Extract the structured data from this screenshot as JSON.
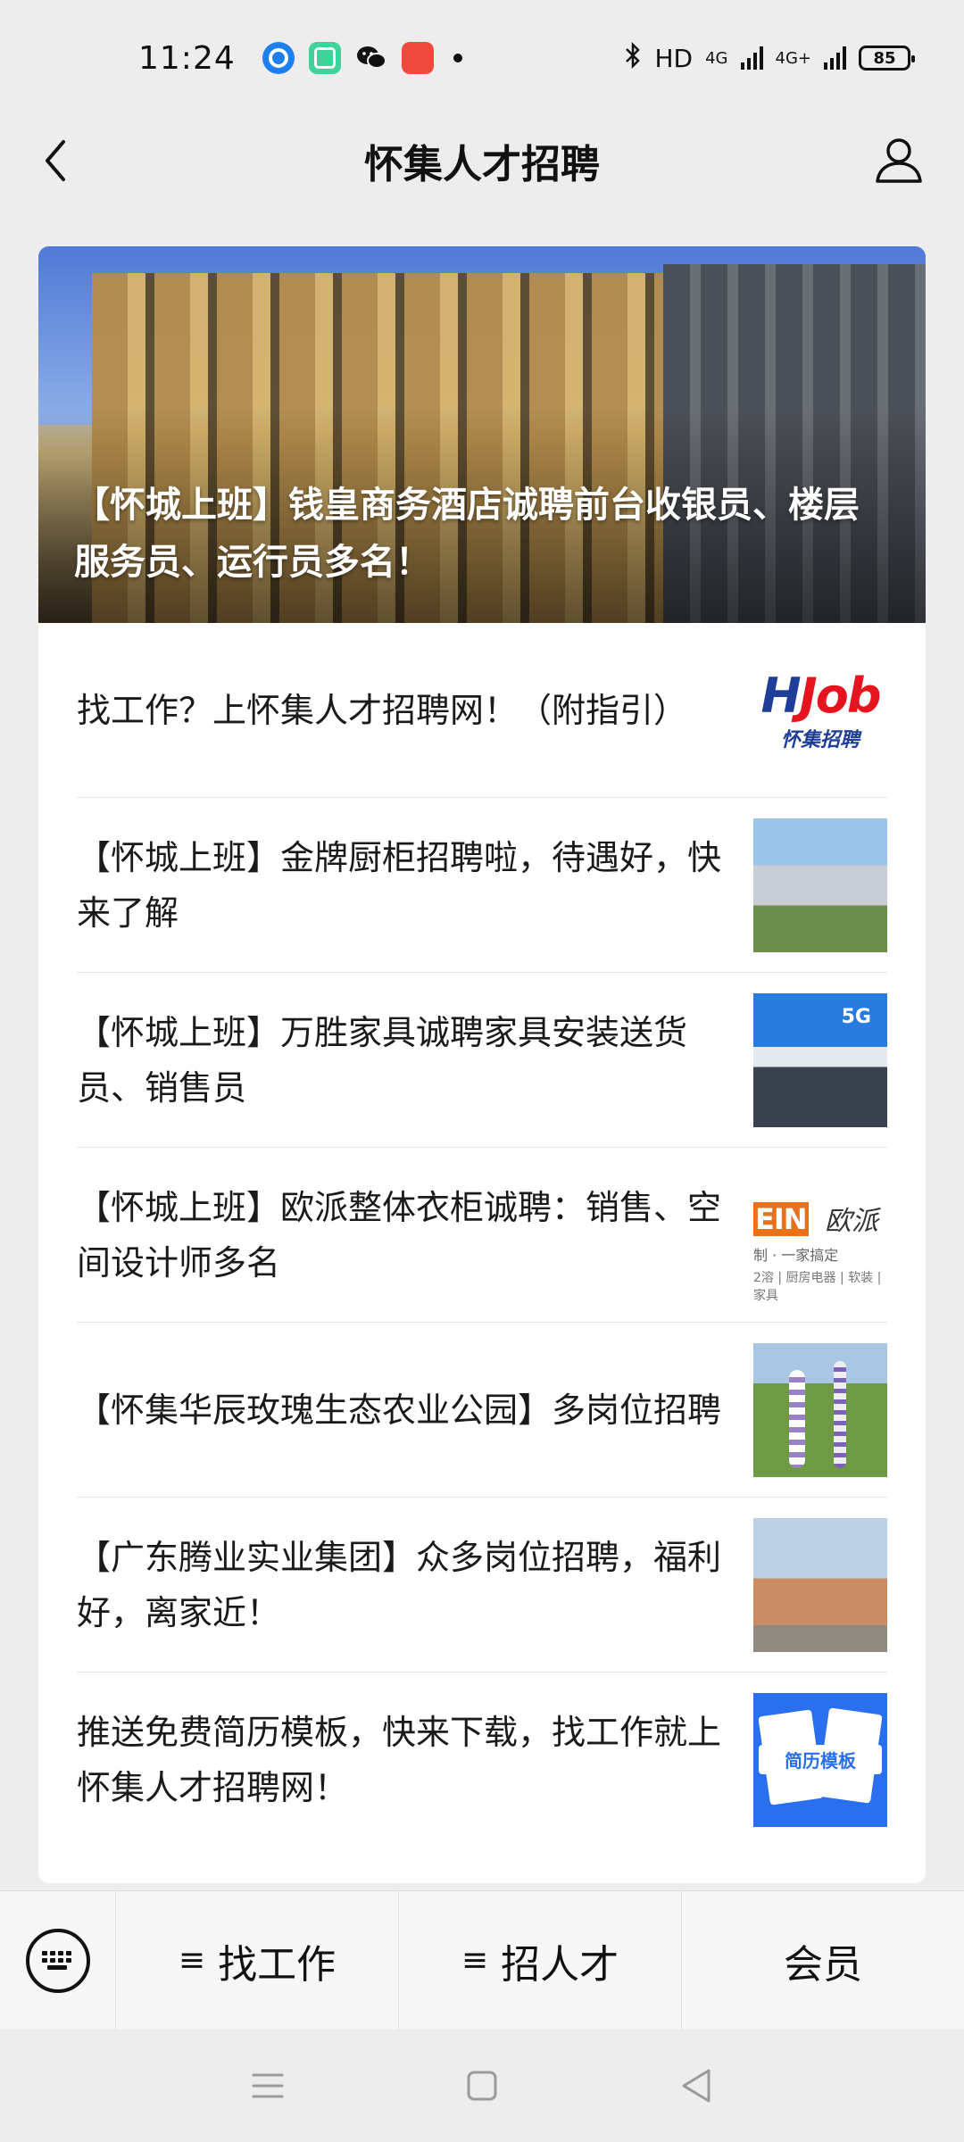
{
  "status_bar": {
    "time": "11:24",
    "app_icons": [
      "qq-browser-icon",
      "app-icon",
      "wechat-icon",
      "red-app-icon"
    ],
    "network": "HD",
    "signal1": "4G",
    "signal2": "4G+",
    "battery": "85"
  },
  "header": {
    "title": "怀集人才招聘"
  },
  "hero": {
    "title": "【怀城上班】钱皇商务酒店诚聘前台收银员、楼层服务员、运行员多名！"
  },
  "articles": [
    {
      "title": "找工作？上怀集人才招聘网！（附指引）",
      "thumb": "logo",
      "logo_main": "Job",
      "logo_letter": "H",
      "logo_sub": "怀集招聘"
    },
    {
      "title": "【怀城上班】金牌厨柜招聘啦，待遇好，快来了解",
      "thumb": "factory"
    },
    {
      "title": "【怀城上班】万胜家具诚聘家具安装送货员、销售员",
      "thumb": "store"
    },
    {
      "title": "【怀城上班】欧派整体衣柜诚聘：销售、空间设计师多名",
      "thumb": "brand",
      "brand_a": "EIN",
      "brand_b": "欧派",
      "brand_c": "制 · 一家搞定",
      "brand_d": "2溶 | 厨房电器 | 软装 | 家具"
    },
    {
      "title": "【怀集华辰玫瑰生态农业公园】多岗位招聘",
      "thumb": "garden"
    },
    {
      "title": "【广东腾业实业集团】众多岗位招聘，福利好，离家近！",
      "thumb": "building"
    },
    {
      "title": "推送免费简历模板，快来下载，找工作就上怀集人才招聘网！",
      "thumb": "resume",
      "resume_label": "简历模板"
    }
  ],
  "bottom_menu": {
    "tab1": "找工作",
    "tab2": "招人才",
    "tab3": "会员",
    "menu_glyph": "≡"
  }
}
